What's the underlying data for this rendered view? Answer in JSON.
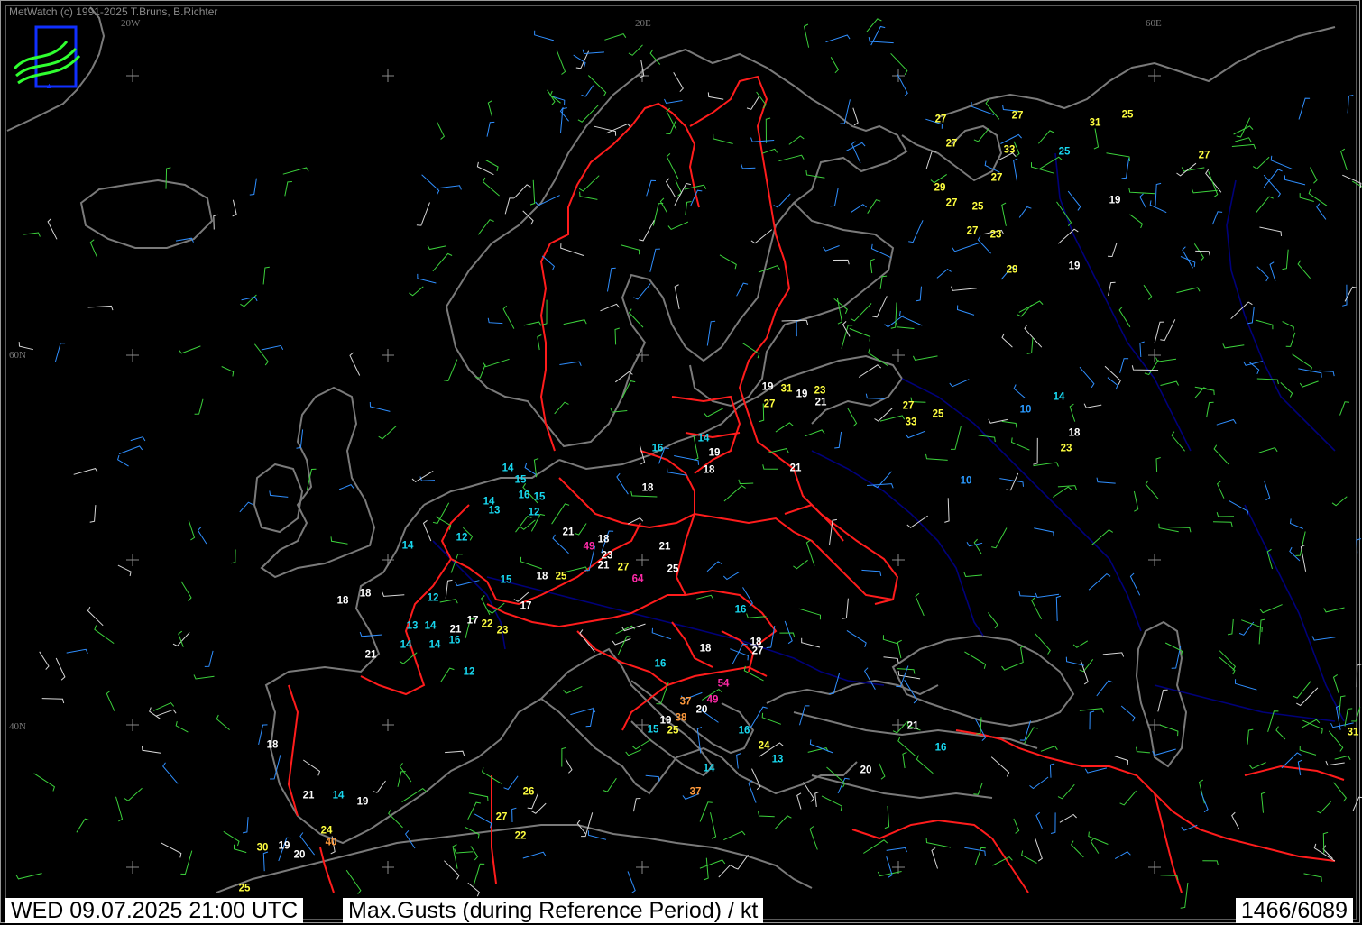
{
  "header": {
    "copyright": "MetWatch  (c) 1991-2025 T.Bruns, B.Richter"
  },
  "logo": {
    "icon": "metwatch-logo-icon"
  },
  "graticule": {
    "longitude_labels": [
      "20W",
      "20E",
      "60E"
    ],
    "latitude_labels": [
      "60N",
      "40N"
    ]
  },
  "status_bar": {
    "datetime": "WED 09.07.2025 21:00 UTC",
    "title": "Max.Gusts (during Reference Period) / kt",
    "station_count": "1466/6089"
  },
  "legend_colors": {
    "border_red": "#ff2020",
    "coast_gray": "#808080",
    "river_blue": "#00008b",
    "cyan_low": "#18d8f0",
    "white_mid": "#ffffff",
    "yellow_high": "#ffff40",
    "orange_strong": "#ff9a3c",
    "magenta_extreme": "#ff2aa8"
  },
  "gust_labels": [
    {
      "v": "27",
      "c": "y"
    },
    {
      "v": "27",
      "c": "y"
    },
    {
      "v": "31",
      "c": "y"
    },
    {
      "v": "25",
      "c": "y"
    },
    {
      "v": "27",
      "c": "y"
    },
    {
      "v": "33",
      "c": "y"
    },
    {
      "v": "25",
      "c": "c"
    },
    {
      "v": "27",
      "c": "y"
    },
    {
      "v": "27",
      "c": "y"
    },
    {
      "v": "29",
      "c": "y"
    },
    {
      "v": "27",
      "c": "y"
    },
    {
      "v": "25",
      "c": "y"
    },
    {
      "v": "19",
      "c": "w"
    },
    {
      "v": "27",
      "c": "y"
    },
    {
      "v": "23",
      "c": "y"
    },
    {
      "v": "29",
      "c": "y"
    },
    {
      "v": "19",
      "c": "w"
    },
    {
      "v": "19",
      "c": "w"
    },
    {
      "v": "31",
      "c": "y"
    },
    {
      "v": "23",
      "c": "y"
    },
    {
      "v": "27",
      "c": "y"
    },
    {
      "v": "19",
      "c": "w"
    },
    {
      "v": "21",
      "c": "w"
    },
    {
      "v": "27",
      "c": "y"
    },
    {
      "v": "25",
      "c": "y"
    },
    {
      "v": "33",
      "c": "y"
    },
    {
      "v": "14",
      "c": "c"
    },
    {
      "v": "10",
      "c": "b"
    },
    {
      "v": "18",
      "c": "w"
    },
    {
      "v": "23",
      "c": "y"
    },
    {
      "v": "10",
      "c": "b"
    },
    {
      "v": "14",
      "c": "c"
    },
    {
      "v": "16",
      "c": "c"
    },
    {
      "v": "19",
      "c": "w"
    },
    {
      "v": "18",
      "c": "w"
    },
    {
      "v": "21",
      "c": "w"
    },
    {
      "v": "14",
      "c": "c"
    },
    {
      "v": "15",
      "c": "c"
    },
    {
      "v": "16",
      "c": "c"
    },
    {
      "v": "15",
      "c": "c"
    },
    {
      "v": "14",
      "c": "c"
    },
    {
      "v": "13",
      "c": "c"
    },
    {
      "v": "12",
      "c": "c"
    },
    {
      "v": "18",
      "c": "w"
    },
    {
      "v": "21",
      "c": "w"
    },
    {
      "v": "49",
      "c": "m"
    },
    {
      "v": "18",
      "c": "w"
    },
    {
      "v": "21",
      "c": "w"
    },
    {
      "v": "23",
      "c": "w"
    },
    {
      "v": "21",
      "c": "w"
    },
    {
      "v": "27",
      "c": "y"
    },
    {
      "v": "64",
      "c": "m"
    },
    {
      "v": "25",
      "c": "w"
    },
    {
      "v": "12",
      "c": "c"
    },
    {
      "v": "14",
      "c": "c"
    },
    {
      "v": "15",
      "c": "c"
    },
    {
      "v": "18",
      "c": "w"
    },
    {
      "v": "25",
      "c": "y"
    },
    {
      "v": "12",
      "c": "c"
    },
    {
      "v": "18",
      "c": "w"
    },
    {
      "v": "18",
      "c": "w"
    },
    {
      "v": "17",
      "c": "w"
    },
    {
      "v": "17",
      "c": "w"
    },
    {
      "v": "22",
      "c": "y"
    },
    {
      "v": "23",
      "c": "y"
    },
    {
      "v": "21",
      "c": "w"
    },
    {
      "v": "13",
      "c": "c"
    },
    {
      "v": "14",
      "c": "c"
    },
    {
      "v": "16",
      "c": "c"
    },
    {
      "v": "14",
      "c": "c"
    },
    {
      "v": "14",
      "c": "c"
    },
    {
      "v": "21",
      "c": "w"
    },
    {
      "v": "12",
      "c": "c"
    },
    {
      "v": "16",
      "c": "c"
    },
    {
      "v": "18",
      "c": "w"
    },
    {
      "v": "27",
      "c": "w"
    },
    {
      "v": "18",
      "c": "w"
    },
    {
      "v": "16",
      "c": "c"
    },
    {
      "v": "54",
      "c": "m"
    },
    {
      "v": "37",
      "c": "o"
    },
    {
      "v": "49",
      "c": "m"
    },
    {
      "v": "20",
      "c": "w"
    },
    {
      "v": "38",
      "c": "o"
    },
    {
      "v": "19",
      "c": "w"
    },
    {
      "v": "15",
      "c": "c"
    },
    {
      "v": "25",
      "c": "y"
    },
    {
      "v": "16",
      "c": "c"
    },
    {
      "v": "24",
      "c": "y"
    },
    {
      "v": "13",
      "c": "c"
    },
    {
      "v": "21",
      "c": "w"
    },
    {
      "v": "16",
      "c": "c"
    },
    {
      "v": "20",
      "c": "w"
    },
    {
      "v": "14",
      "c": "c"
    },
    {
      "v": "37",
      "c": "o"
    },
    {
      "v": "18",
      "c": "w"
    },
    {
      "v": "21",
      "c": "w"
    },
    {
      "v": "14",
      "c": "c"
    },
    {
      "v": "19",
      "c": "w"
    },
    {
      "v": "26",
      "c": "y"
    },
    {
      "v": "27",
      "c": "y"
    },
    {
      "v": "24",
      "c": "y"
    },
    {
      "v": "40",
      "c": "o"
    },
    {
      "v": "22",
      "c": "y"
    },
    {
      "v": "30",
      "c": "y"
    },
    {
      "v": "19",
      "c": "w"
    },
    {
      "v": "20",
      "c": "w"
    },
    {
      "v": "25",
      "c": "y"
    },
    {
      "v": "31",
      "c": "y"
    }
  ]
}
